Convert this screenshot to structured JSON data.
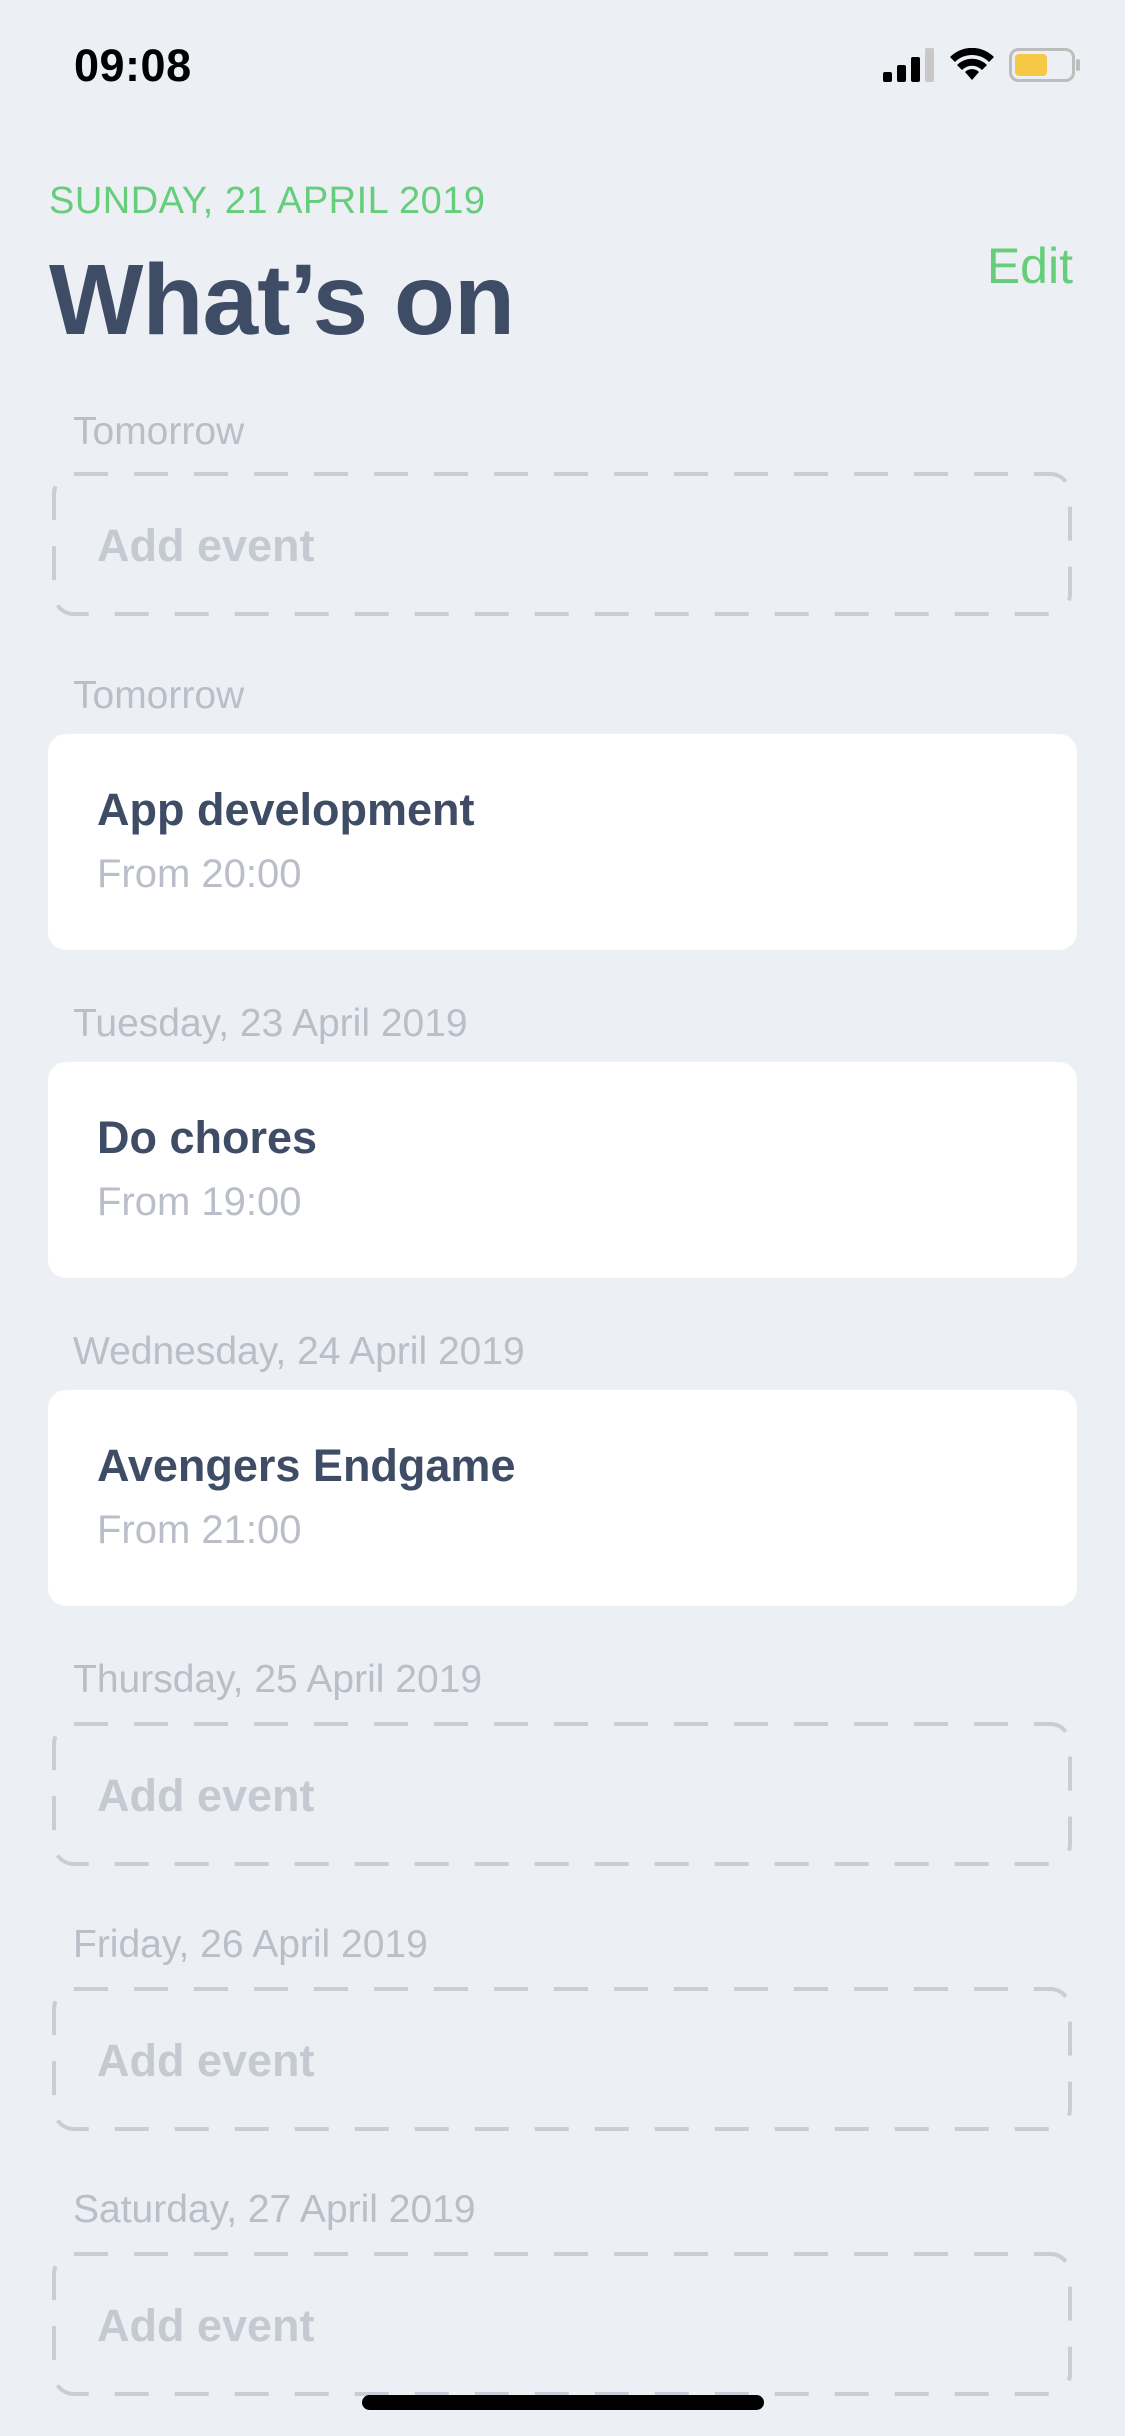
{
  "status_bar": {
    "time": "09:08",
    "icons": [
      "cellular-signal-icon",
      "wifi-icon",
      "battery-icon"
    ],
    "battery_color": "#f5c945"
  },
  "header": {
    "date": "SUNDAY, 21 APRIL 2019",
    "title": "What’s on",
    "edit_label": "Edit"
  },
  "sections": [
    {
      "label": "Tomorrow",
      "add_label": "Add event"
    },
    {
      "label": "Tomorrow",
      "event": {
        "title": "App development",
        "time": "From 20:00"
      }
    },
    {
      "label": "Tuesday, 23 April 2019",
      "event": {
        "title": "Do chores",
        "time": "From 19:00"
      }
    },
    {
      "label": "Wednesday, 24 April 2019",
      "event": {
        "title": "Avengers Endgame",
        "time": "From 21:00"
      }
    },
    {
      "label": "Thursday, 25 April 2019",
      "add_label": "Add event"
    },
    {
      "label": "Friday, 26 April 2019",
      "add_label": "Add event"
    },
    {
      "label": "Saturday, 27 April 2019",
      "add_label": "Add event"
    }
  ],
  "colors": {
    "accent": "#66cd7a",
    "title": "#3f4c66",
    "muted": "#b9bec8",
    "background": "#eceff4"
  }
}
